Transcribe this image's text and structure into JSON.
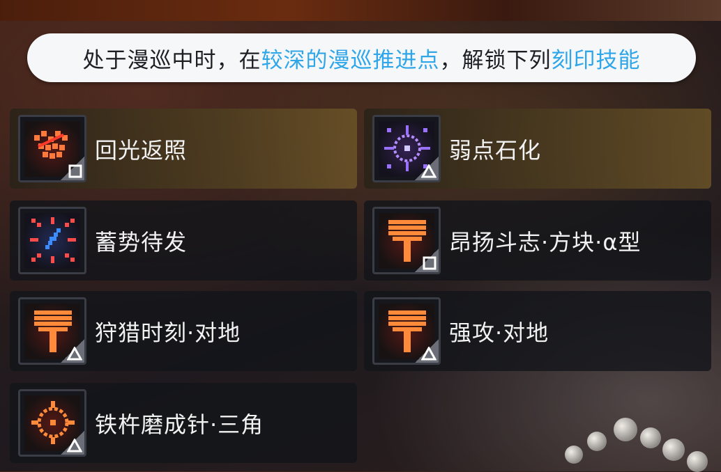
{
  "banner": {
    "part1": "处于漫巡中时，在",
    "highlight1": "较深的漫巡推进点",
    "part2": "，解锁下列",
    "highlight2": "刻印技能",
    "highlight_color": "#2ea6e8"
  },
  "skills": [
    {
      "name": "回光返照",
      "icon": "hammer-sparks-icon",
      "badge": "square-badge",
      "highlighted": true
    },
    {
      "name": "弱点石化",
      "icon": "crosshair-target-icon",
      "badge": "triangle-badge",
      "highlighted": true
    },
    {
      "name": "蓄势待发",
      "icon": "charging-bolt-icon",
      "badge": "none",
      "highlighted": false
    },
    {
      "name": "昂扬斗志·方块·α型",
      "icon": "axe-icon",
      "badge": "square-badge",
      "highlighted": false
    },
    {
      "name": "狩猎时刻·对地",
      "icon": "axe-icon",
      "badge": "triangle-badge",
      "highlighted": false
    },
    {
      "name": "强攻·对地",
      "icon": "axe-icon",
      "badge": "triangle-badge",
      "highlighted": false
    },
    {
      "name": "铁杵磨成针·三角",
      "icon": "gear-ring-icon",
      "badge": "triangle-badge",
      "highlighted": false
    }
  ]
}
